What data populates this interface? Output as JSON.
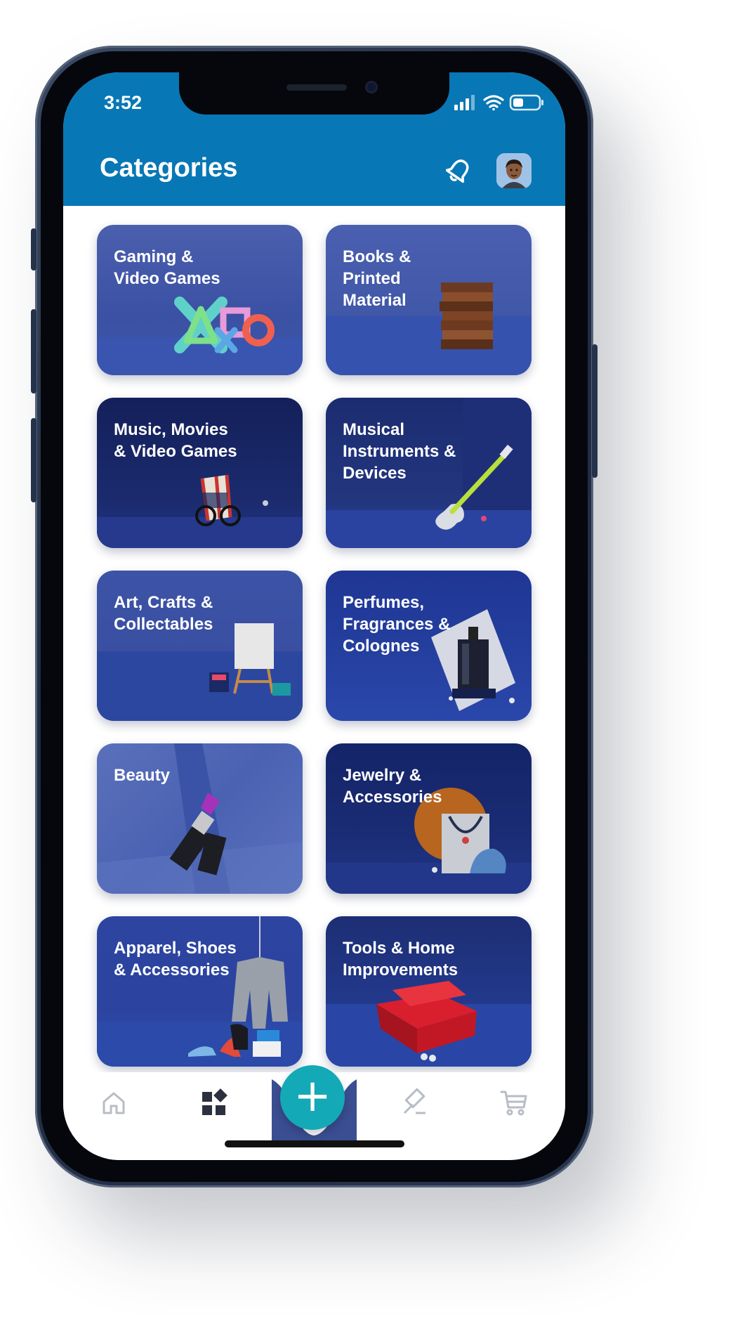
{
  "status_bar": {
    "time": "3:52"
  },
  "header": {
    "title": "Categories",
    "notification_icon": "bell-icon",
    "avatar_icon": "user-avatar-icon"
  },
  "categories": [
    {
      "label": "Gaming &\nVideo Games",
      "icon": "game-controller-symbols-icon"
    },
    {
      "label": "Books &\nPrinted\nMaterial",
      "icon": "books-stack-icon"
    },
    {
      "label": "Music, Movies\n& Video Games",
      "icon": "popcorn-glasses-icon"
    },
    {
      "label": "Musical\nInstruments &\nDevices",
      "icon": "electric-guitar-icon"
    },
    {
      "label": "Art, Crafts &\nCollectables",
      "icon": "easel-icon"
    },
    {
      "label": "Perfumes,\nFragrances &\nColognes",
      "icon": "perfume-bottle-icon"
    },
    {
      "label": "Beauty",
      "icon": "lipstick-icon"
    },
    {
      "label": "Jewelry &\nAccessories",
      "icon": "necklace-icon"
    },
    {
      "label": "Apparel, Shoes\n& Accessories",
      "icon": "blazer-shoes-icon"
    },
    {
      "label": "Tools & Home\nImprovements",
      "icon": "toolbox-icon"
    }
  ],
  "tab_bar": {
    "items": [
      {
        "icon": "home-icon"
      },
      {
        "icon": "categories-icon",
        "active": true
      },
      {
        "icon": "add-icon"
      },
      {
        "icon": "auction-gavel-icon"
      },
      {
        "icon": "cart-icon"
      }
    ],
    "fab_label": "+"
  },
  "colors": {
    "header": "#0877b5",
    "accent": "#14a9b6",
    "card_dark": "#1b2d6b",
    "card_light": "#3f58a8"
  }
}
